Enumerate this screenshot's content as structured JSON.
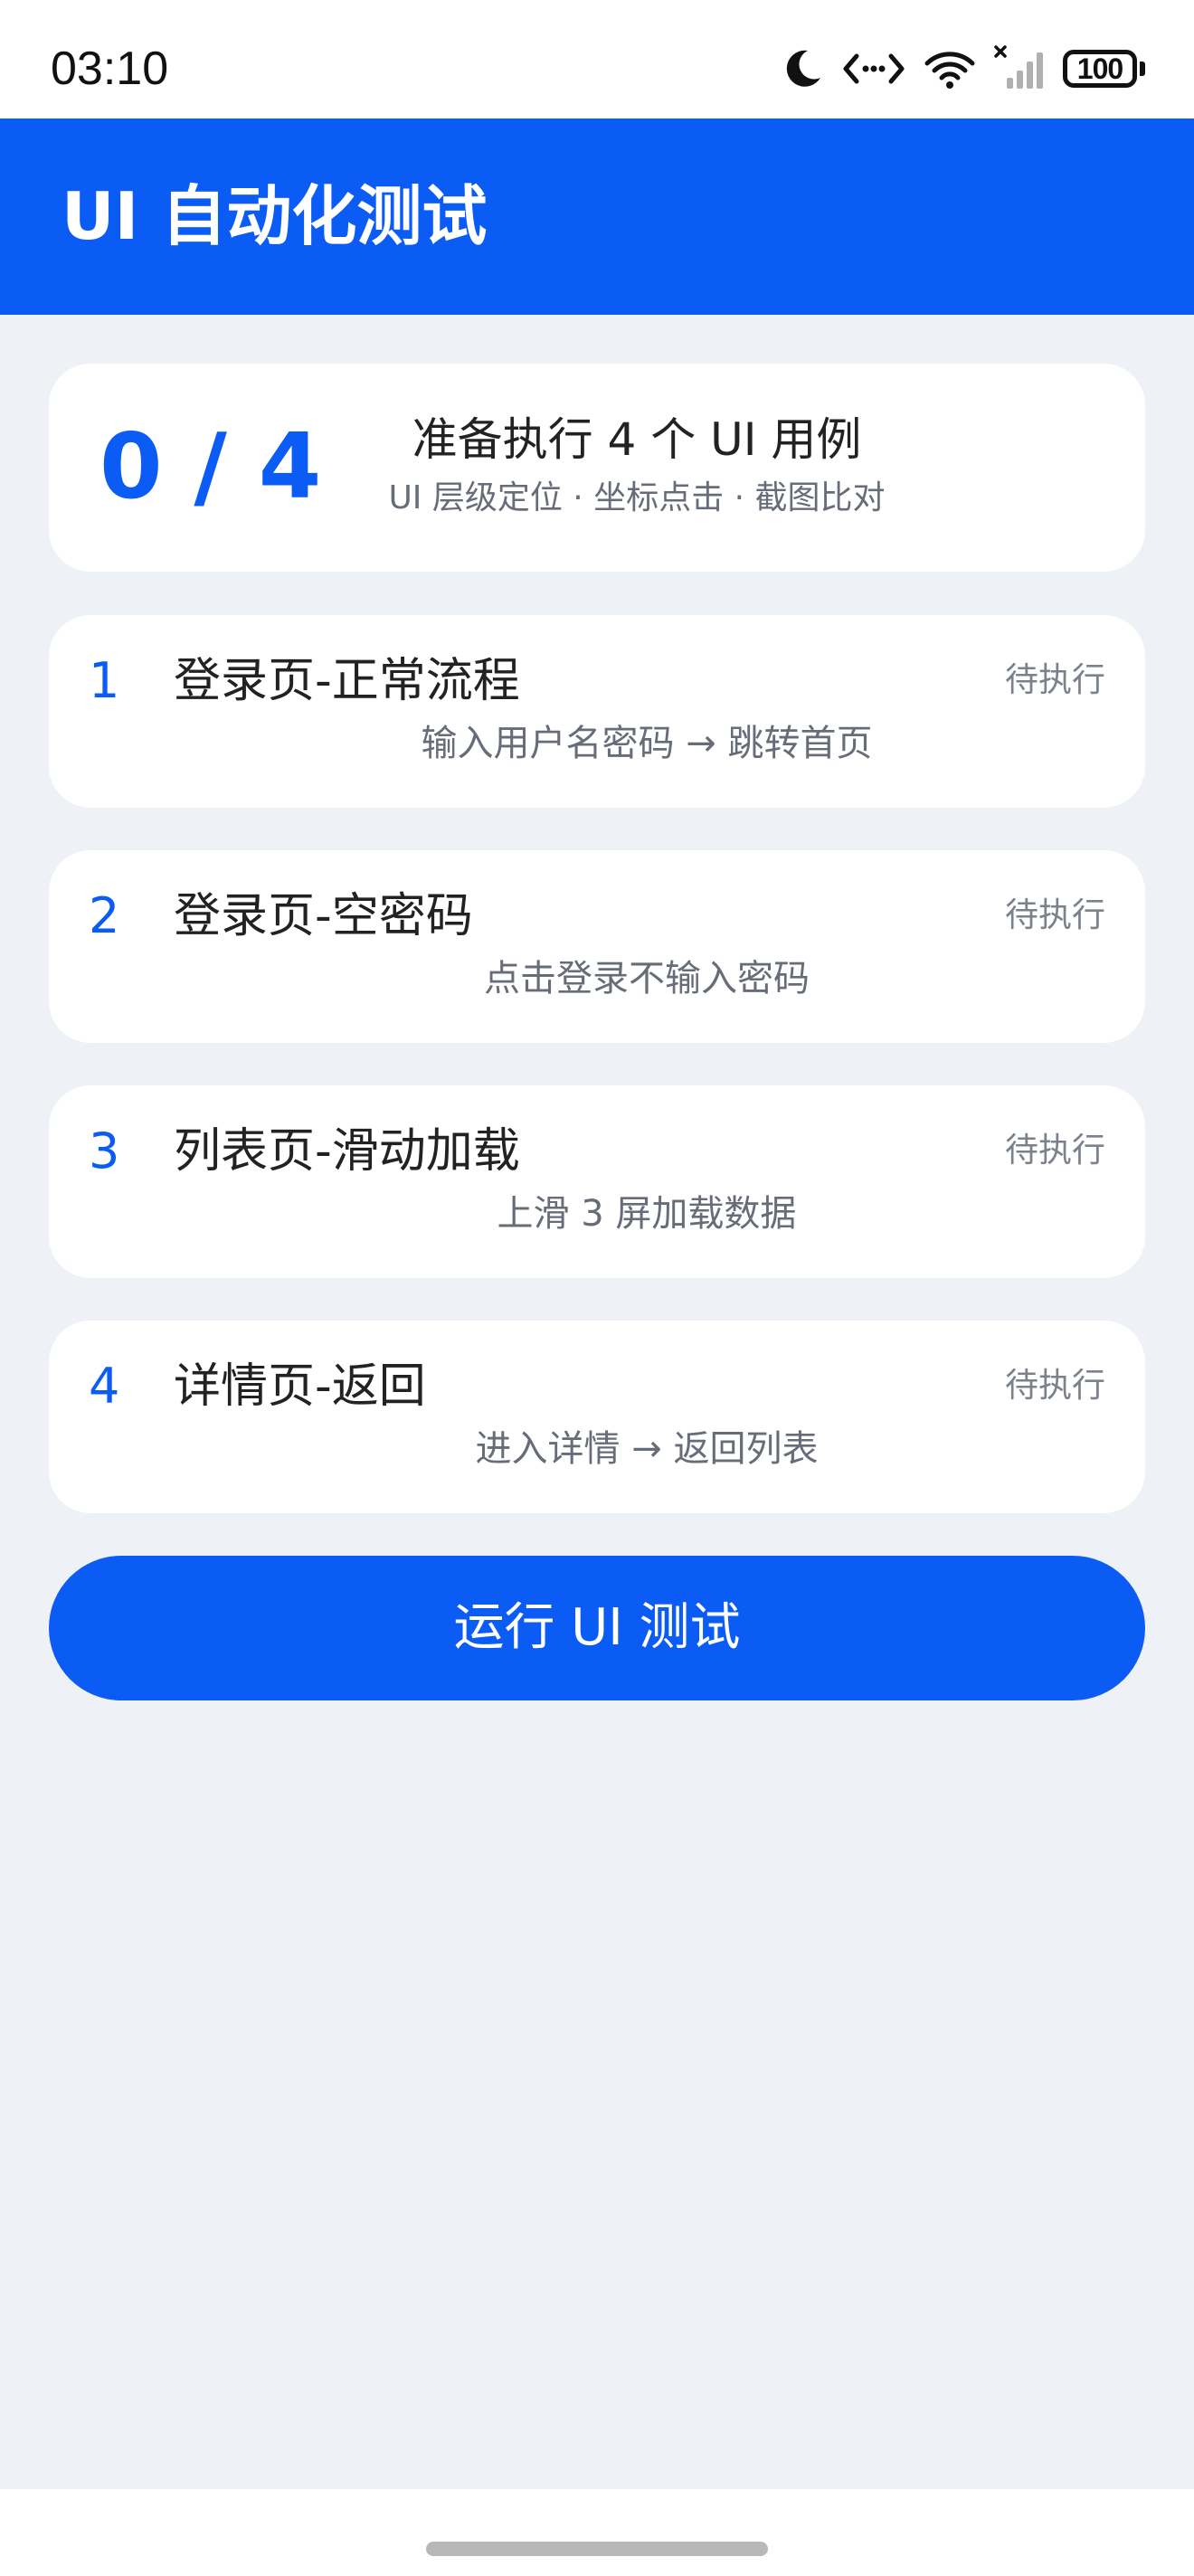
{
  "status_bar": {
    "time": "03:10",
    "battery": "100",
    "icons": [
      "moon-icon",
      "code-icon",
      "wifi-icon",
      "signal-icon",
      "battery-icon"
    ]
  },
  "app": {
    "title": "UI 自动化测试",
    "accent_color": "#0a5cf5"
  },
  "summary": {
    "progress": "0 / 4",
    "title": "准备执行 4 个 UI 用例",
    "subtitle": "UI 层级定位 · 坐标点击 · 截图比对"
  },
  "cases": [
    {
      "index": "1",
      "title": "登录页-正常流程",
      "status": "待执行",
      "description": "输入用户名密码 → 跳转首页"
    },
    {
      "index": "2",
      "title": "登录页-空密码",
      "status": "待执行",
      "description": "点击登录不输入密码"
    },
    {
      "index": "3",
      "title": "列表页-滑动加载",
      "status": "待执行",
      "description": "上滑 3 屏加载数据"
    },
    {
      "index": "4",
      "title": "详情页-返回",
      "status": "待执行",
      "description": "进入详情 → 返回列表"
    }
  ],
  "run_button": {
    "label": "运行 UI 测试"
  }
}
